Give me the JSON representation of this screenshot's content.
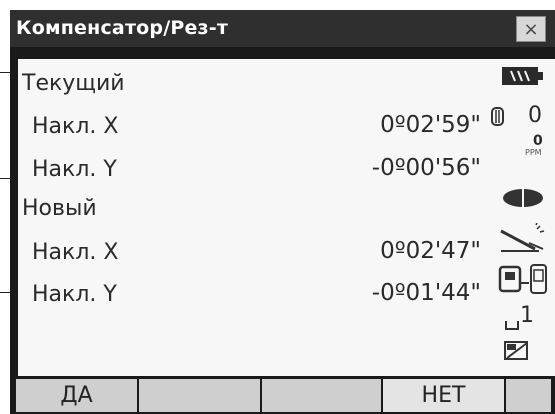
{
  "window": {
    "title": "Компенсатор/Рез-т",
    "close_symbol": "×"
  },
  "current": {
    "heading": "Текущий",
    "tilt_x_label": "Накл. X",
    "tilt_x_value": "0º02'59\"",
    "tilt_y_label": "Накл. Y",
    "tilt_y_value": "-0º00'56\""
  },
  "new": {
    "heading": "Новый",
    "tilt_x_label": "Накл. X",
    "tilt_x_value": "0º02'47\"",
    "tilt_y_label": "Накл. Y",
    "tilt_y_value": "-0º01'44\""
  },
  "status": {
    "battery_icon": "battery-icon",
    "prism_icon": "prism-icon",
    "prism_constant": "0",
    "ppm_label": "PPM",
    "ppm_value": "0",
    "laser_icon": "eye-laser-icon",
    "tilt_icon": "tilt-icon",
    "comm_icon": "bluetooth-device-icon",
    "keypad_mode": "1",
    "memory_icon": "card-icon"
  },
  "softkeys": {
    "yes_label": "ДА",
    "no_label": "НЕТ"
  }
}
